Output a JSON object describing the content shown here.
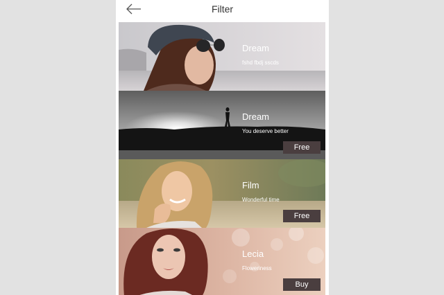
{
  "header": {
    "title": "Filter",
    "back_icon": "arrow-left-icon"
  },
  "filters": [
    {
      "name": "Dream",
      "description": "fshd fbdj sscds",
      "price": ""
    },
    {
      "name": "Dream",
      "description": "You deserve better",
      "price": "Free"
    },
    {
      "name": "Film",
      "description": "Wonderful time",
      "price": "Free"
    },
    {
      "name": "Lecia",
      "description": "Floweriness",
      "price": "Buy"
    }
  ],
  "colors": {
    "background": "#e2e2e2",
    "panel": "#ffffff",
    "button": "#4a3e3f"
  }
}
